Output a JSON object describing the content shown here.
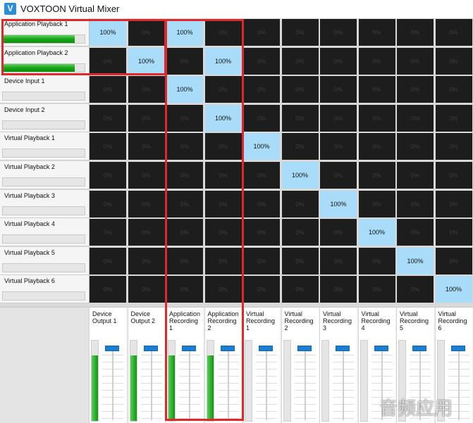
{
  "window": {
    "title": "VOXTOON Virtual Mixer",
    "icon_letter": "V"
  },
  "inputs": [
    {
      "label": "Application Playback 1",
      "level": 0.88
    },
    {
      "label": "Application Playback 2",
      "level": 0.88
    },
    {
      "label": "Device Input 1",
      "level": 0
    },
    {
      "label": "Device Input 2",
      "level": 0
    },
    {
      "label": "Virtual Playback 1",
      "level": 0
    },
    {
      "label": "Virtual Playback 2",
      "level": 0
    },
    {
      "label": "Virtual Playback 3",
      "level": 0
    },
    {
      "label": "Virtual Playback 4",
      "level": 0
    },
    {
      "label": "Virtual Playback 5",
      "level": 0
    },
    {
      "label": "Virtual Playback 6",
      "level": 0
    }
  ],
  "outputs": [
    {
      "label": "Device Output 1",
      "level": 0.82
    },
    {
      "label": "Device Output 2",
      "level": 0.82
    },
    {
      "label": "Application Recording 1",
      "level": 0.82
    },
    {
      "label": "Application Recording 2",
      "level": 0.82
    },
    {
      "label": "Virtual Recording 1",
      "level": 0
    },
    {
      "label": "Virtual Recording 2",
      "level": 0
    },
    {
      "label": "Virtual Recording 3",
      "level": 0
    },
    {
      "label": "Virtual Recording 4",
      "level": 0
    },
    {
      "label": "Virtual Recording 5",
      "level": 0
    },
    {
      "label": "Virtual Recording 6",
      "level": 0
    }
  ],
  "matrix": [
    [
      "100%",
      "0%",
      "100%",
      "0%",
      "0%",
      "0%",
      "0%",
      "0%",
      "0%",
      "0%"
    ],
    [
      "0%",
      "100%",
      "0%",
      "100%",
      "0%",
      "0%",
      "0%",
      "0%",
      "0%",
      "0%"
    ],
    [
      "0%",
      "0%",
      "100%",
      "0%",
      "0%",
      "0%",
      "0%",
      "0%",
      "0%",
      "0%"
    ],
    [
      "0%",
      "0%",
      "0%",
      "100%",
      "0%",
      "0%",
      "0%",
      "0%",
      "0%",
      "0%"
    ],
    [
      "0%",
      "0%",
      "0%",
      "0%",
      "100%",
      "0%",
      "0%",
      "0%",
      "0%",
      "0%"
    ],
    [
      "0%",
      "0%",
      "0%",
      "0%",
      "0%",
      "100%",
      "0%",
      "0%",
      "0%",
      "0%"
    ],
    [
      "0%",
      "0%",
      "0%",
      "0%",
      "0%",
      "0%",
      "100%",
      "0%",
      "0%",
      "0%"
    ],
    [
      "0%",
      "0%",
      "0%",
      "0%",
      "0%",
      "0%",
      "0%",
      "100%",
      "0%",
      "0%"
    ],
    [
      "0%",
      "0%",
      "0%",
      "0%",
      "0%",
      "0%",
      "0%",
      "0%",
      "100%",
      "0%"
    ],
    [
      "0%",
      "0%",
      "0%",
      "0%",
      "0%",
      "0%",
      "0%",
      "0%",
      "0%",
      "100%"
    ]
  ],
  "highlight_color": "#e0282a",
  "watermark": "音频应用"
}
